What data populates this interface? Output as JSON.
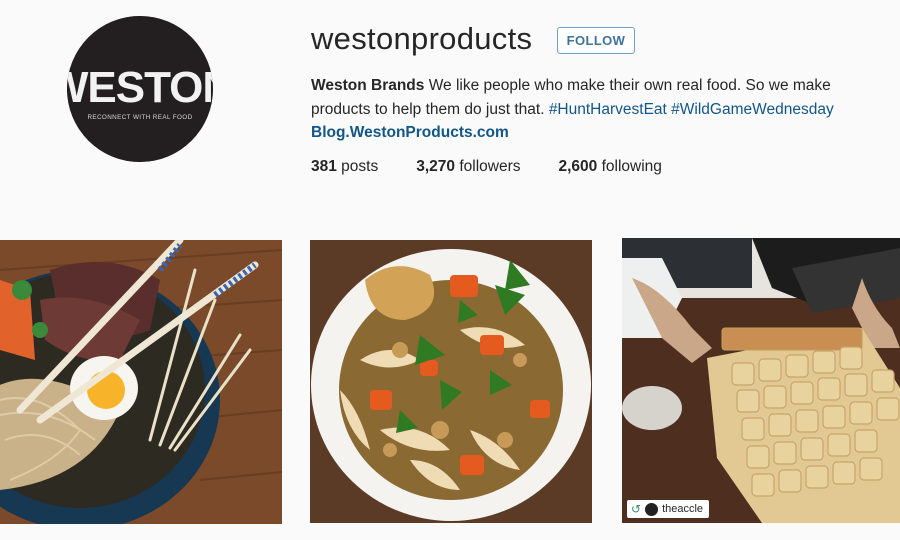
{
  "profile": {
    "username": "westonproducts",
    "follow_label": "FOLLOW",
    "avatar": {
      "logo_text": "WESTON",
      "tagline": "RECONNECT WITH REAL FOOD"
    },
    "bio": {
      "name": "Weston Brands",
      "text": " We like people who make their own real food. So we make products to help them do just that. ",
      "hashtag1": "#HuntHarvestEat",
      "hashtag2": "#WildGameWednesday",
      "link": "Blog.WestonProducts.com"
    },
    "stats": {
      "posts_count": "381",
      "posts_label": " posts",
      "followers_count": "3,270",
      "followers_label": " followers",
      "following_count": "2,600",
      "following_label": " following"
    }
  },
  "photos": [
    {
      "subject": "ramen-bowl"
    },
    {
      "subject": "chicken-noodle-soup"
    },
    {
      "subject": "ravioli-dough",
      "repost_user": "theaccle"
    }
  ],
  "colors": {
    "link": "#125688",
    "follow_border": "#6fa0d0",
    "follow_text": "#3f729b",
    "page_bg": "#fafafa"
  },
  "icons": {
    "repost": "repost-icon"
  }
}
